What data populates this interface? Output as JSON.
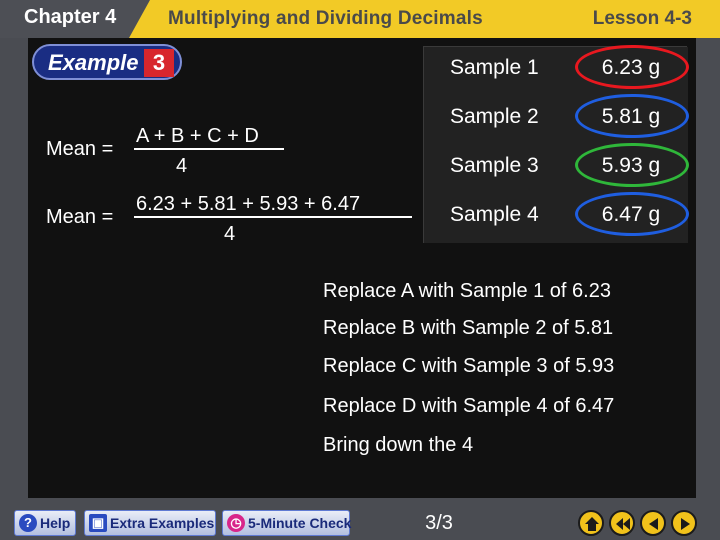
{
  "header": {
    "chapter": "Chapter 4",
    "title": "Multiplying and Dividing Decimals",
    "lesson": "Lesson 4-3"
  },
  "example": {
    "label": "Example",
    "number": "3"
  },
  "samples": [
    {
      "label": "Sample 1",
      "value": "6.23 g",
      "ring_color": "#e8181f"
    },
    {
      "label": "Sample 2",
      "value": "5.81 g",
      "ring_color": "#1f5ee0"
    },
    {
      "label": "Sample 3",
      "value": "5.93 g",
      "ring_color": "#2fb73a"
    },
    {
      "label": "Sample 4",
      "value": "6.47 g",
      "ring_color": "#1f5ee0"
    }
  ],
  "formula1": {
    "lhs": "Mean =",
    "numerator": "A + B + C + D",
    "denominator": "4"
  },
  "formula2": {
    "lhs": "Mean =",
    "numerator": "6.23 + 5.81 + 5.93 + 6.47",
    "denominator": "4"
  },
  "steps": [
    "Replace A with Sample 1 of 6.23",
    "Replace B with Sample 2 of 5.81",
    "Replace C with Sample 3 of 5.93",
    "Replace D with Sample 4 of 6.47",
    "Bring down the 4"
  ],
  "nav": {
    "help": "Help",
    "extra": "Extra Examples",
    "five_minute": "5-Minute Check",
    "page": "3/3"
  },
  "colors": {
    "header_bg": "#f2ca26",
    "board_bg": "#111111",
    "example_blue": "#1a2d83",
    "example_red": "#d8262d",
    "nav_yellow": "#f1c21b"
  }
}
